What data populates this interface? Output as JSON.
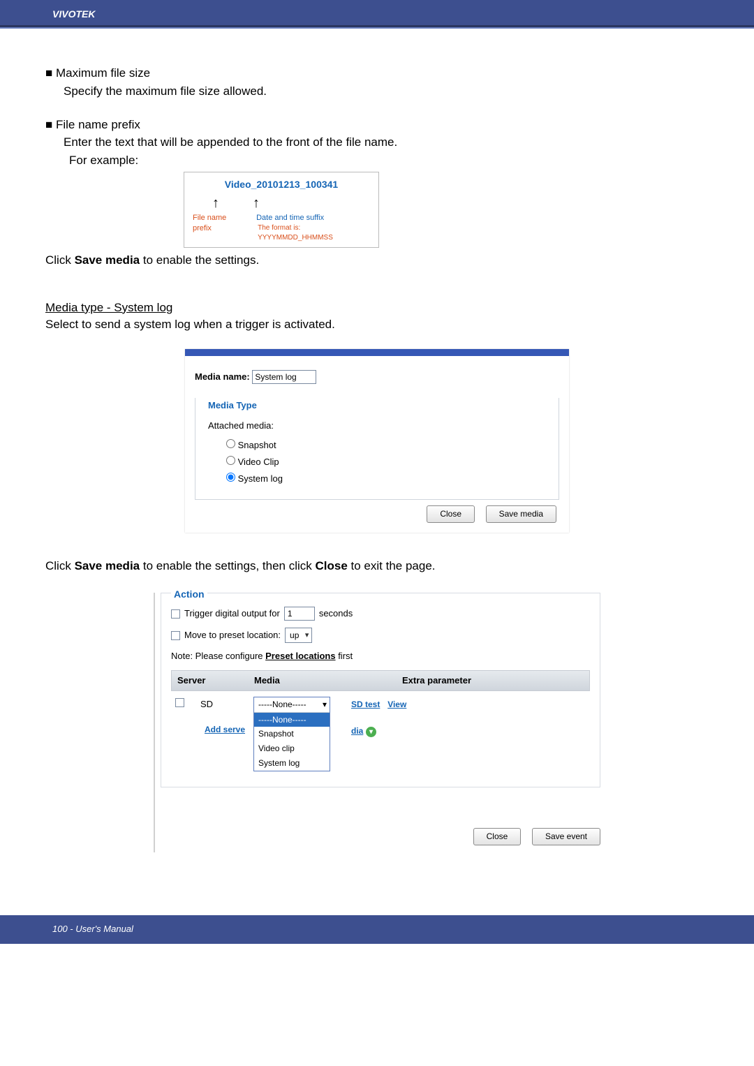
{
  "header": {
    "brand": "VIVOTEK"
  },
  "section1": {
    "bullet1_title": "■ Maximum file size",
    "bullet1_desc": "Specify the maximum file size allowed.",
    "bullet2_title": "■ File name prefix",
    "bullet2_desc": "Enter the text that will be appended to the front of the file name.",
    "bullet2_example_label": "For example:",
    "example_filename": "Video_20101213_100341",
    "example_up1": "↑",
    "example_up2": "↑",
    "example_prefix_label": "File name prefix",
    "example_suffix_label": "Date and time suffix",
    "example_format_label": "The format is: YYYYMMDD_HHMMSS",
    "click_save_1_pre": "Click ",
    "click_save_1_bold": "Save media",
    "click_save_1_post": " to enable the settings."
  },
  "section2": {
    "heading": "Media type - System log",
    "desc": "Select to send a system log when a trigger is activated."
  },
  "media_dialog": {
    "media_name_label": "Media name:",
    "media_name_value": "System log",
    "legend": "Media Type",
    "attached_label": "Attached media:",
    "radio_snapshot": "Snapshot",
    "radio_videoclip": "Video Clip",
    "radio_systemlog": "System log",
    "btn_close": "Close",
    "btn_save": "Save media"
  },
  "between": {
    "line_pre": "Click ",
    "line_b1": "Save media",
    "line_mid": " to enable the settings, then click ",
    "line_b2": "Close",
    "line_post": " to exit the page."
  },
  "action": {
    "legend": "Action",
    "row1_label": "Trigger digital output for",
    "row1_value": "1",
    "row1_unit": "seconds",
    "row2_label": "Move to preset location:",
    "row2_select_value": "up",
    "note_pre": "Note: Please configure ",
    "note_link": "Preset locations",
    "note_post": " first",
    "th_server": "Server",
    "th_media": "Media",
    "th_extra": "Extra parameter",
    "row_sd": "SD",
    "dd_selected": "-----None-----",
    "dd_none_highlight": "-----None-----",
    "dd_snapshot": "Snapshot",
    "dd_videoclip": "Video clip",
    "dd_systemlog": "System log",
    "sdtest": "SD test",
    "view": "View",
    "add_server": "Add serve",
    "dia": "dia",
    "green_icon": "▾",
    "btn_close": "Close",
    "btn_save": "Save event"
  },
  "footer": {
    "text": "100 - User's Manual"
  }
}
